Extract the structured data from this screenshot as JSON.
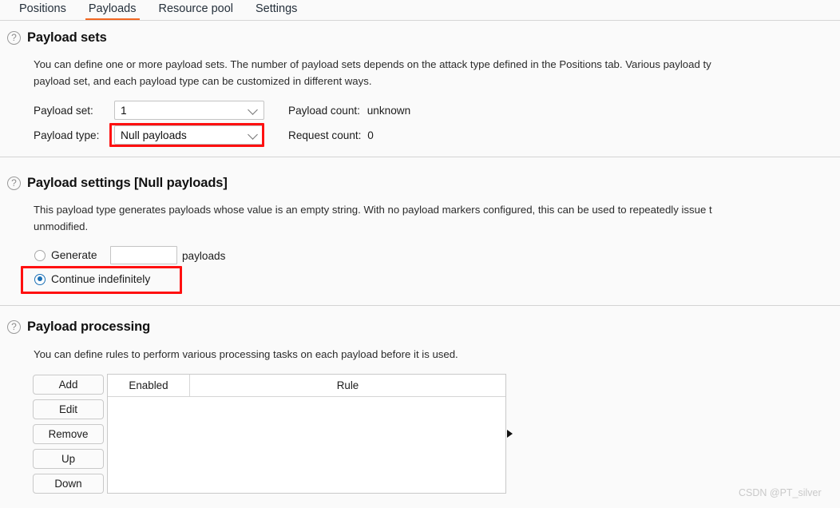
{
  "tabs": [
    {
      "label": "Positions",
      "active": false
    },
    {
      "label": "Payloads",
      "active": true
    },
    {
      "label": "Resource pool",
      "active": false
    },
    {
      "label": "Settings",
      "active": false
    }
  ],
  "help_glyph": "?",
  "payload_sets": {
    "title": "Payload sets",
    "description_line1": "You can define one or more payload sets. The number of payload sets depends on the attack type defined in the Positions tab. Various payload ty",
    "description_line2": "payload set, and each payload type can be customized in different ways.",
    "payload_set_label": "Payload set:",
    "payload_set_value": "1",
    "payload_type_label": "Payload type:",
    "payload_type_value": "Null payloads",
    "payload_count_label": "Payload count:",
    "payload_count_value": "unknown",
    "request_count_label": "Request count:",
    "request_count_value": "0"
  },
  "payload_settings": {
    "title": "Payload settings [Null payloads]",
    "description_line1": "This payload type generates payloads whose value is an empty string. With no payload markers configured, this can be used to repeatedly issue t",
    "description_line2": "unmodified.",
    "generate_label": "Generate",
    "generate_value": "",
    "generate_suffix": "payloads",
    "continue_label": "Continue indefinitely",
    "selected_option": "continue_indefinitely"
  },
  "payload_processing": {
    "title": "Payload processing",
    "description": "You can define rules to perform various processing tasks on each payload before it is used.",
    "buttons": [
      "Add",
      "Edit",
      "Remove",
      "Up",
      "Down"
    ],
    "columns": [
      "Enabled",
      "Rule"
    ],
    "rows": []
  },
  "annotations": {
    "accent_color": "#ff1010",
    "active_tab_color": "#f26722"
  },
  "watermark": "CSDN @PT_silver"
}
